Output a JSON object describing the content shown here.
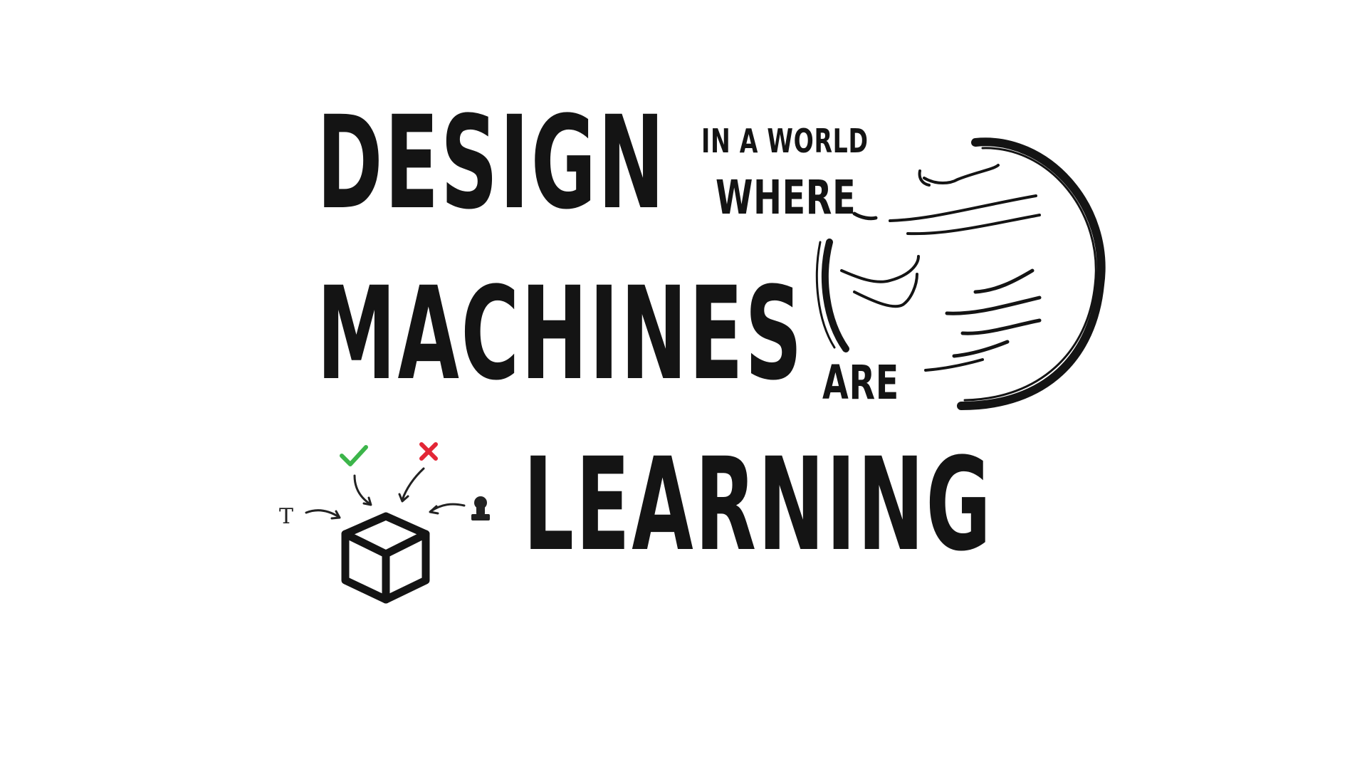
{
  "title": {
    "line1": "DESIGN",
    "phrase1_top": "IN A WORLD",
    "phrase1_bottom": "WHERE",
    "line2": "MACHINES",
    "phrase2": "ARE",
    "line3": "LEARNING"
  },
  "diagram": {
    "input_text_glyph": "T",
    "icons": [
      "checkmark-icon",
      "cross-icon",
      "cube-icon",
      "stamp-icon",
      "globe-icon"
    ],
    "colors": {
      "ink": "#141414",
      "check": "#3cb54a",
      "cross": "#e32636",
      "background": "#ffffff"
    }
  }
}
